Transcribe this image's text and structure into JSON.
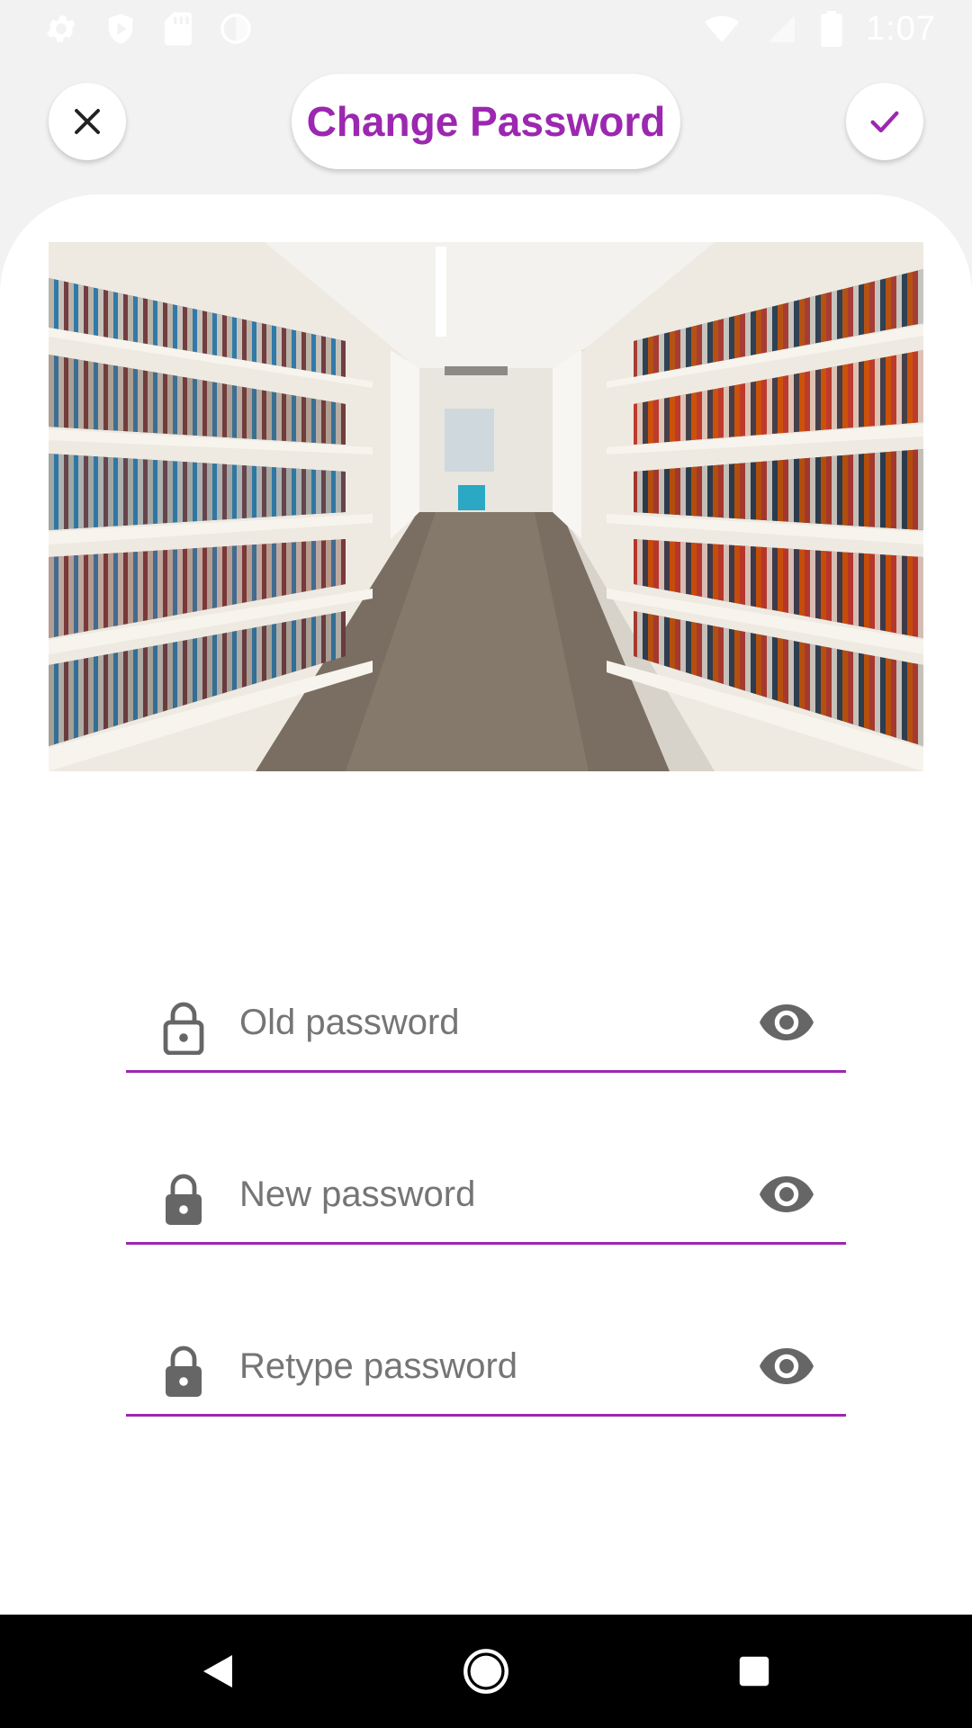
{
  "status_bar": {
    "time": "1:07",
    "left_icons": [
      "gear-icon",
      "shield-icon",
      "sd-card-icon",
      "circle-icon"
    ],
    "right_icons": [
      "wifi-icon",
      "signal-icon",
      "battery-icon"
    ]
  },
  "header": {
    "title": "Change Password",
    "close_icon": "close-icon",
    "confirm_icon": "check-icon"
  },
  "hero": {
    "image": "library-bookshelves-photo"
  },
  "form": {
    "fields": [
      {
        "placeholder": "Old password",
        "value": "",
        "lock_icon": "lock-open-icon",
        "toggle_icon": "eye-icon"
      },
      {
        "placeholder": "New password",
        "value": "",
        "lock_icon": "lock-icon",
        "toggle_icon": "eye-icon"
      },
      {
        "placeholder": "Retype password",
        "value": "",
        "lock_icon": "lock-icon",
        "toggle_icon": "eye-icon"
      }
    ]
  },
  "nav_bar": {
    "buttons": [
      "back-icon",
      "home-icon",
      "recents-icon"
    ]
  },
  "colors": {
    "accent": "#9c27b0",
    "background": "#f2f2f2",
    "card": "#ffffff",
    "icon_gray": "#666666",
    "nav_bar": "#000000"
  }
}
